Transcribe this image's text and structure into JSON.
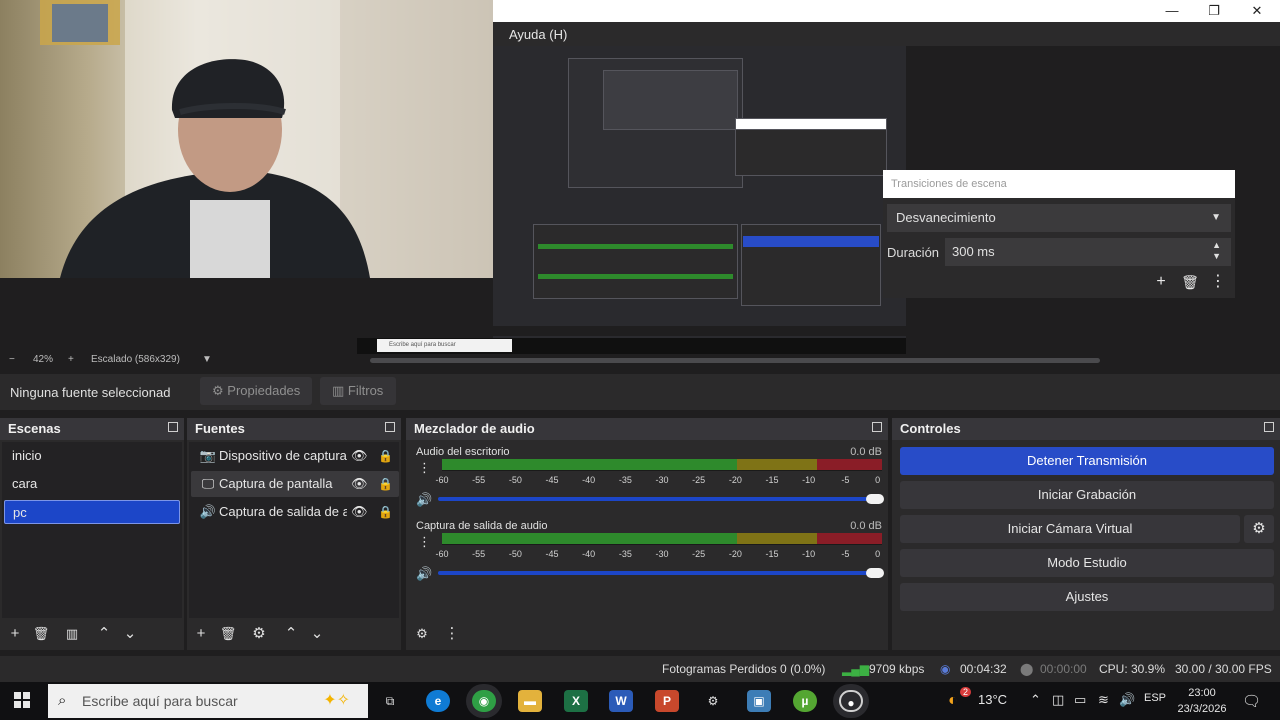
{
  "window": {
    "menu_help": "Ayuda (H)",
    "minimize": "—",
    "restore": "❐",
    "close": "✕"
  },
  "preview": {
    "inner_search_placeholder": "Escribe aquí para buscar"
  },
  "transitions": {
    "title": "Transiciones de escena",
    "selected": "Desvanecimiento",
    "duration_label": "Duración",
    "duration_value": "300 ms"
  },
  "zoom": {
    "minus": "−",
    "percent": "42%",
    "plus": "+",
    "scaling": "Escalado (586x329)"
  },
  "properties": {
    "no_source": "Ninguna fuente seleccionad",
    "properties_label": "Propiedades",
    "filters_label": "Filtros"
  },
  "scenes": {
    "title": "Escenas",
    "items": [
      "inicio",
      "cara",
      "pc"
    ],
    "selected_index": 2
  },
  "sources": {
    "title": "Fuentes",
    "items": [
      {
        "label": "Dispositivo de captura",
        "icon": "camera-icon"
      },
      {
        "label": "Captura de pantalla",
        "icon": "monitor-icon"
      },
      {
        "label": "Captura de salida de audio",
        "icon": "speaker-icon"
      }
    ]
  },
  "mixer": {
    "title": "Mezclador de audio",
    "channels": [
      {
        "name": "Audio del escritorio",
        "db": "0.0 dB",
        "volume": 1.0
      },
      {
        "name": "Captura de salida de audio",
        "db": "0.0 dB",
        "volume": 1.0
      }
    ],
    "ticks": [
      "-60",
      "-55",
      "-50",
      "-45",
      "-40",
      "-35",
      "-30",
      "-25",
      "-20",
      "-15",
      "-10",
      "-5",
      "0"
    ]
  },
  "controls": {
    "title": "Controles",
    "stop_stream": "Detener Transmisión",
    "start_recording": "Iniciar Grabación",
    "start_virtual_cam": "Iniciar Cámara Virtual",
    "studio_mode": "Modo Estudio",
    "settings": "Ajustes"
  },
  "status": {
    "dropped_frames": "Fotogramas Perdidos 0 (0.0%)",
    "bitrate": "9709 kbps",
    "stream_time": "00:04:32",
    "record_time": "00:00:00",
    "cpu": "CPU: 30.9%",
    "fps": "30.00 / 30.00 FPS"
  },
  "taskbar": {
    "search_placeholder": "Escribe aquí para buscar",
    "weather_badge": "2",
    "temperature": "13°C",
    "language": "ESP",
    "time": "23:00",
    "date": "23/3/2026",
    "apps": [
      "task-view",
      "edge",
      "chrome",
      "explorer",
      "excel",
      "word",
      "powerpoint",
      "settings",
      "generic",
      "utorrent",
      "obs"
    ]
  },
  "colors": {
    "accent": "#284cc8",
    "panel": "#2b2a2b",
    "background": "#1f1e1f",
    "meter_green": "#2e8a2c",
    "meter_yellow": "#7f7316",
    "meter_red": "#8a1d27"
  }
}
